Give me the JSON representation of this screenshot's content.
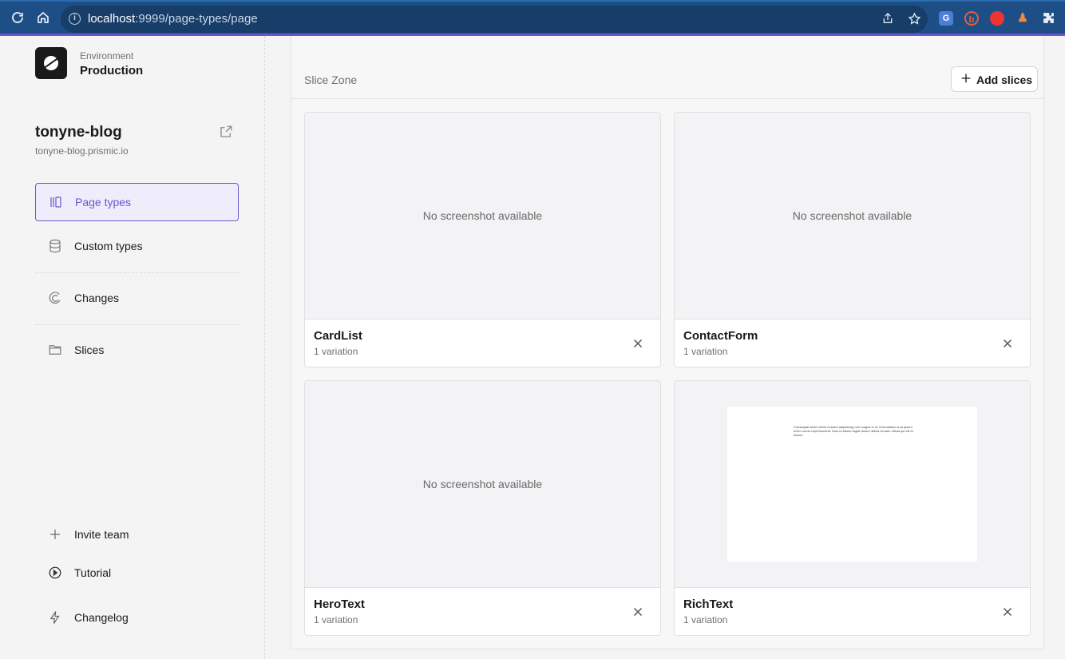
{
  "browser": {
    "url_host": "localhost",
    "url_path": ":9999/page-types/page"
  },
  "sidebar": {
    "environment_label": "Environment",
    "environment_value": "Production",
    "repo_name": "tonyne-blog",
    "repo_url": "tonyne-blog.prismic.io",
    "nav": [
      {
        "label": "Page types",
        "icon": "page-types-icon",
        "active": true
      },
      {
        "label": "Custom types",
        "icon": "database-icon",
        "active": false
      },
      {
        "label": "Changes",
        "icon": "changes-icon",
        "active": false
      },
      {
        "label": "Slices",
        "icon": "folder-icon",
        "active": false
      }
    ],
    "footer": [
      {
        "label": "Invite team",
        "icon": "plus-icon"
      },
      {
        "label": "Tutorial",
        "icon": "play-circle-icon"
      },
      {
        "label": "Changelog",
        "icon": "lightning-icon"
      }
    ]
  },
  "main": {
    "slice_zone_title": "Slice Zone",
    "add_slices_label": "Add slices",
    "cards": [
      {
        "name": "CardList",
        "variations": "1 variation",
        "thumbnail_text": "No screenshot available"
      },
      {
        "name": "ContactForm",
        "variations": "1 variation",
        "thumbnail_text": "No screenshot available"
      },
      {
        "name": "HeroText",
        "variations": "1 variation",
        "thumbnail_text": "No screenshot available"
      },
      {
        "name": "RichText",
        "variations": "1 variation",
        "preview_text": "Consequat amet minim nostrud adipisicing non magna in ut. Exercitation sunt ipsum enim Lorem reprehenderit. Duis id labore fugiat dolore officia veniam officia qui elit id dolore."
      }
    ]
  },
  "colors": {
    "accent": "#6d54cf",
    "browser_bar": "#1d4f86"
  }
}
